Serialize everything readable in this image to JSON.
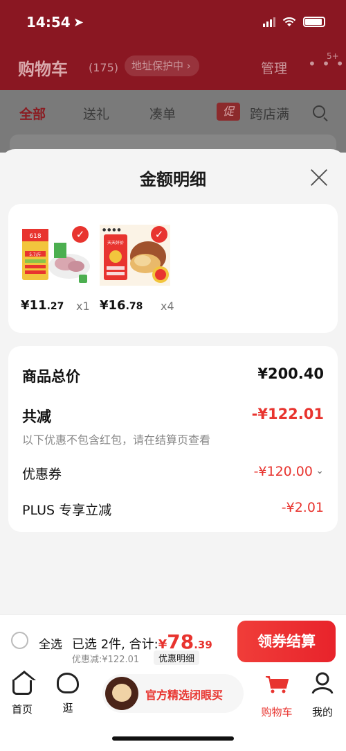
{
  "status_bar": {
    "time": "14:54"
  },
  "header": {
    "title": "购物车",
    "count": "(175)",
    "address_pill": "地址保护中 ›",
    "manage": "管理",
    "more": "• • •",
    "more_badge": "5+"
  },
  "tabs": [
    {
      "label": "全部"
    },
    {
      "label": "送礼"
    },
    {
      "label": "凑单"
    },
    {
      "label": "跨店满"
    }
  ],
  "promo_tag": "促",
  "sheet": {
    "title": "金额明细",
    "products": [
      {
        "price_main": "¥11",
        "price_decimal": ".27",
        "qty": "x1",
        "thumb_badge": "618",
        "thumb_note": "5.7/斤"
      },
      {
        "price_main": "¥16",
        "price_decimal": ".78",
        "qty": "x4",
        "thumb_badge": "天天好价"
      }
    ],
    "details": {
      "total_label": "商品总价",
      "total_value": "¥200.40",
      "reduce_label": "共减",
      "reduce_value": "-¥122.01",
      "reduce_note": "以下优惠不包含红包，请在结算页查看",
      "coupon_label": "优惠券",
      "coupon_value": "-¥120.00",
      "coupon_chevron": "⌄",
      "plus_label": "PLUS 专享立减",
      "plus_value": "-¥2.01"
    }
  },
  "checkout": {
    "select_all": "全选",
    "selected_text": "已选 2件, 合计:",
    "currency": "¥",
    "amount_int": "78",
    "amount_dec": ".39",
    "discount_line": "优惠减:¥122.01",
    "detail_chip": "优惠明细",
    "pay_button": "领券结算"
  },
  "tabbar": {
    "home": "首页",
    "browse": "逛",
    "promo": "官方精选闭眼买",
    "cart": "购物车",
    "me": "我的"
  },
  "colors": {
    "accent": "#e8342f",
    "header_dim": "#8a1722"
  }
}
